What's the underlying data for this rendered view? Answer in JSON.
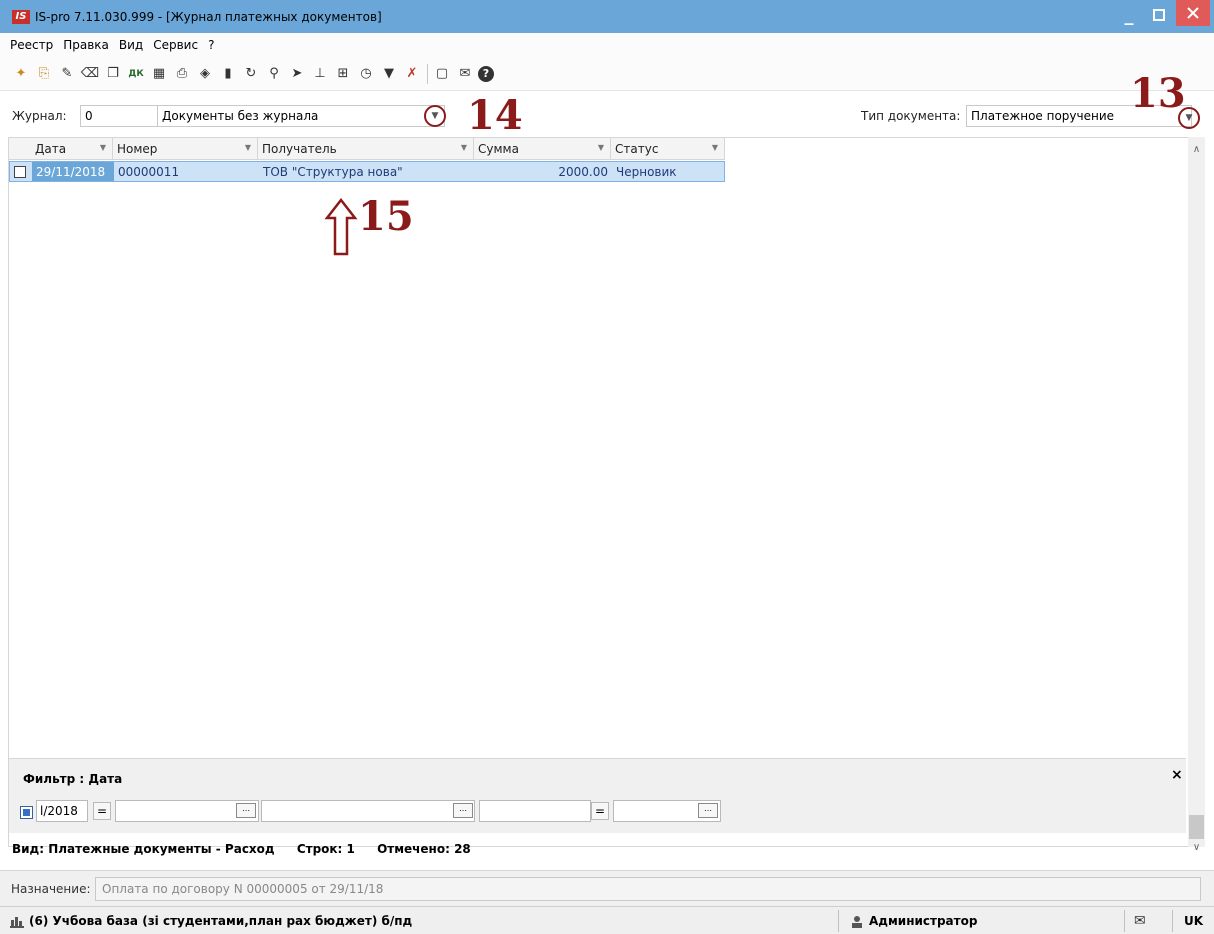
{
  "window": {
    "logo": "IS",
    "title": "IS-pro 7.11.030.999 - [Журнал платежных документов]"
  },
  "menu": [
    "Реестр",
    "Правка",
    "Вид",
    "Сервис",
    "?"
  ],
  "toolbar_icons": [
    "new-doc-icon",
    "create-icon",
    "edit-icon",
    "delete-icon",
    "copy-icon",
    "dk-icon",
    "calc-icon",
    "print-icon",
    "package-icon",
    "bookmark-icon",
    "refresh-icon",
    "search-icon",
    "next-icon",
    "tree-icon",
    "table-icon",
    "clock-icon",
    "filter-icon",
    "clear-filter-icon",
    "form-icon",
    "mail-icon",
    "help-icon"
  ],
  "journal": {
    "label": "Журнал:",
    "code": "0",
    "name": "Документы без журнала"
  },
  "doc_type": {
    "label": "Тип документа:",
    "value": "Платежное поручение"
  },
  "annotations": {
    "n13": "13",
    "n14": "14",
    "n15": "15"
  },
  "grid": {
    "columns": [
      "Дата",
      "Номер",
      "Получатель",
      "Сумма",
      "Статус"
    ],
    "rows": [
      {
        "date": "29/11/2018",
        "number": "00000011",
        "recipient": "ТОВ \"Структура нова\"",
        "sum": "2000.00",
        "status": "Черновик"
      }
    ]
  },
  "filter": {
    "title": "Фильтр : Дата",
    "date_fragment": "l/2018",
    "eq1": "=",
    "eq2": "=",
    "close": "×"
  },
  "status": {
    "view": "Вид: Платежные документы - Расход",
    "rows": "Строк: 1",
    "marked": "Отмечено: 28"
  },
  "purpose": {
    "label": "Назначение:",
    "value": "Оплата по договору N 00000005 от 29/11/18"
  },
  "bottom": {
    "db": "(6) Учбова база (зі студентами,план рах бюджет) б/пд",
    "user": "Администратор",
    "lang": "UK"
  },
  "colors": {
    "titlebar": "#6aa7d8",
    "selected_row": "#cde2f7",
    "annotation": "#8b1b1b",
    "close_button": "#e15a5a"
  }
}
